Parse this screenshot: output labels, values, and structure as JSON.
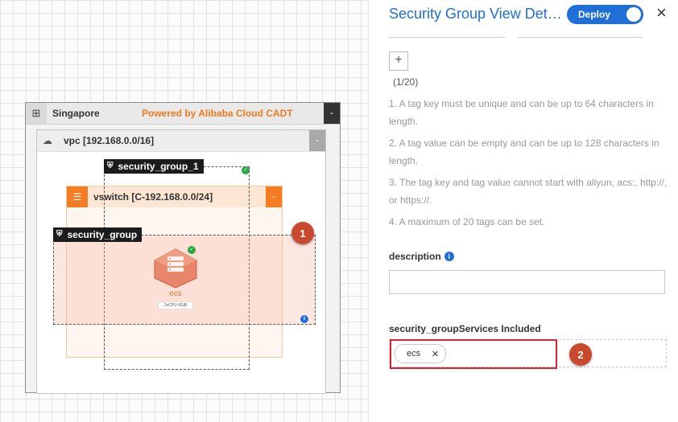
{
  "canvas": {
    "region": {
      "name": "Singapore",
      "powered_by": "Powered by Alibaba Cloud CADT",
      "collapse_label": "-"
    },
    "vpc": {
      "name": "vpc [192.168.0.0/16]",
      "collapse_label": "-"
    },
    "vswitch": {
      "name": "vswitch [C-192.168.0.0/24]",
      "collapse_label": "-"
    },
    "security_group_1": {
      "name": "security_group_1"
    },
    "security_group": {
      "name": "security_group"
    },
    "ecs": {
      "name": "ecs",
      "spec": "2vCPU  4GiB"
    },
    "callout_1": "1"
  },
  "panel": {
    "title": "Security Group View Details",
    "deploy_label": "Deploy",
    "close_label": "×",
    "tags": {
      "add_label": "+",
      "count": "(1/20)",
      "tips": [
        "1. A tag key must be unique and can be up to 64 characters in length.",
        "2. A tag value can be empty and can be up to 128 characters in length.",
        "3. The tag key and tag value cannot start with aliyun, acs:, http://, or https://.",
        "4. A maximum of 20 tags can be set."
      ]
    },
    "description": {
      "label": "description",
      "value": ""
    },
    "services": {
      "label": "security_groupServices Included",
      "chip_label": "ecs",
      "chip_remove": "×",
      "callout_2": "2"
    }
  },
  "colors": {
    "accent": "#1f6fd6",
    "orange": "#f47c22",
    "callout": "#c8492d",
    "highlight_red": "#d9242f"
  },
  "icons": [
    "region-icon",
    "cloud-icon",
    "vswitch-icon",
    "shield-icon",
    "check-icon",
    "info-icon",
    "ecs-server-icon",
    "plus-icon",
    "close-icon"
  ]
}
